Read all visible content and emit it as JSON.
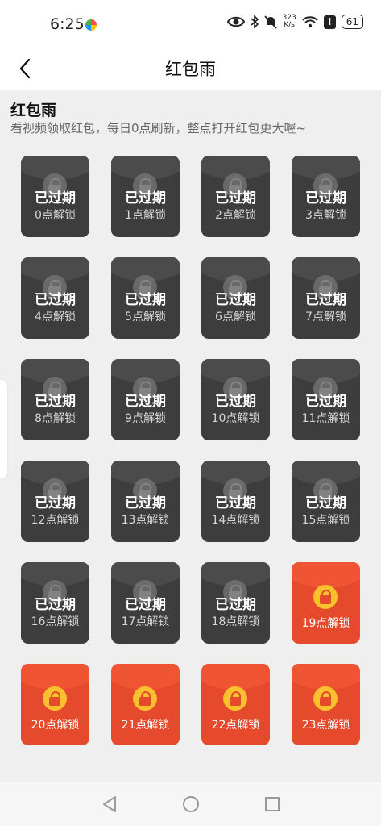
{
  "status_bar": {
    "time": "6:25",
    "net_speed_value": "323",
    "net_speed_unit": "K/s",
    "battery": "61",
    "icons": [
      "eye-icon",
      "bluetooth-icon",
      "mute-icon",
      "wifi-icon",
      "alert-icon",
      "battery-icon"
    ]
  },
  "header": {
    "title": "红包雨",
    "back_icon": "chevron-left-icon"
  },
  "section": {
    "title": "红包雨",
    "subtitle": "看视频领取红包，每日0点刷新，整点打开红包更大喔~"
  },
  "cards": [
    {
      "state": "expired",
      "status": "已过期",
      "unlock": "0点解锁"
    },
    {
      "state": "expired",
      "status": "已过期",
      "unlock": "1点解锁"
    },
    {
      "state": "expired",
      "status": "已过期",
      "unlock": "2点解锁"
    },
    {
      "state": "expired",
      "status": "已过期",
      "unlock": "3点解锁"
    },
    {
      "state": "expired",
      "status": "已过期",
      "unlock": "4点解锁"
    },
    {
      "state": "expired",
      "status": "已过期",
      "unlock": "5点解锁"
    },
    {
      "state": "expired",
      "status": "已过期",
      "unlock": "6点解锁"
    },
    {
      "state": "expired",
      "status": "已过期",
      "unlock": "7点解锁"
    },
    {
      "state": "expired",
      "status": "已过期",
      "unlock": "8点解锁"
    },
    {
      "state": "expired",
      "status": "已过期",
      "unlock": "9点解锁"
    },
    {
      "state": "expired",
      "status": "已过期",
      "unlock": "10点解锁"
    },
    {
      "state": "expired",
      "status": "已过期",
      "unlock": "11点解锁"
    },
    {
      "state": "expired",
      "status": "已过期",
      "unlock": "12点解锁"
    },
    {
      "state": "expired",
      "status": "已过期",
      "unlock": "13点解锁"
    },
    {
      "state": "expired",
      "status": "已过期",
      "unlock": "14点解锁"
    },
    {
      "state": "expired",
      "status": "已过期",
      "unlock": "15点解锁"
    },
    {
      "state": "expired",
      "status": "已过期",
      "unlock": "16点解锁"
    },
    {
      "state": "expired",
      "status": "已过期",
      "unlock": "17点解锁"
    },
    {
      "state": "expired",
      "status": "已过期",
      "unlock": "18点解锁"
    },
    {
      "state": "locked",
      "status": "",
      "unlock": "19点解锁"
    },
    {
      "state": "locked",
      "status": "",
      "unlock": "20点解锁"
    },
    {
      "state": "locked",
      "status": "",
      "unlock": "21点解锁"
    },
    {
      "state": "locked",
      "status": "",
      "unlock": "22点解锁"
    },
    {
      "state": "locked",
      "status": "",
      "unlock": "23点解锁"
    }
  ],
  "colors": {
    "expired_card": "#3d3d3d",
    "locked_card": "#e44a2b",
    "lock_badge": "#fbc02d",
    "page_bg": "#efefef"
  },
  "nav_bar": {
    "icons": [
      "back-triangle-icon",
      "home-circle-icon",
      "recents-square-icon"
    ]
  }
}
